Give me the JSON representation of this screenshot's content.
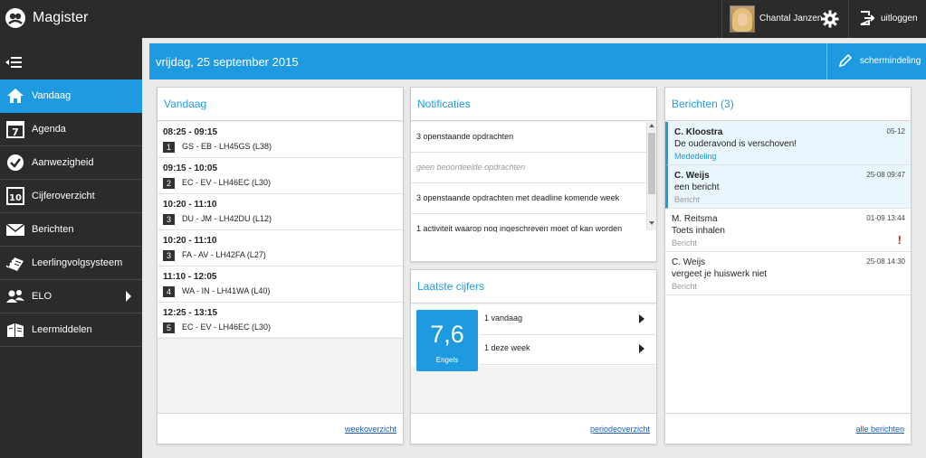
{
  "topbar": {
    "app_title": "Magister",
    "user_name": "Chantal Janzen",
    "logout_label": "uitloggen"
  },
  "sidebar": {
    "items": [
      {
        "label": "Vandaag",
        "icon": "home-icon",
        "active": true
      },
      {
        "label": "Agenda",
        "icon": "calendar-icon"
      },
      {
        "label": "Aanwezigheid",
        "icon": "check-icon"
      },
      {
        "label": "Cijferoverzicht",
        "icon": "grade-10-icon"
      },
      {
        "label": "Berichten",
        "icon": "envelope-icon"
      },
      {
        "label": "Leerlingvolgsysteem",
        "icon": "notebook-icon"
      },
      {
        "label": "ELO",
        "icon": "people-icon",
        "has_submenu": true
      },
      {
        "label": "Leermiddelen",
        "icon": "books-icon"
      }
    ]
  },
  "header": {
    "date": "vrijdag, 25 september 2015",
    "layout_label": "schermindeling"
  },
  "vandaag": {
    "title": "Vandaag",
    "lessons": [
      {
        "time": "08:25 - 09:15",
        "hour": "1",
        "desc": "GS - EB - LH45GS (L38)"
      },
      {
        "time": "09:15 - 10:05",
        "hour": "2",
        "desc": "EC - EV - LH46EC (L30)"
      },
      {
        "time": "10:20 - 11:10",
        "hour": "3",
        "desc": "DU - JM - LH42DU (L12)"
      },
      {
        "time": "10:20 - 11:10",
        "hour": "3",
        "desc": "FA - AV - LH42FA (L27)"
      },
      {
        "time": "11:10 - 12:05",
        "hour": "4",
        "desc": "WA - IN - LH41WA (L40)"
      },
      {
        "time": "12:25 - 13:15",
        "hour": "5",
        "desc": "EC - EV - LH46EC (L30)"
      }
    ],
    "footer_link": "weekoverzicht"
  },
  "notificaties": {
    "title": "Notificaties",
    "items": [
      {
        "text": "3 openstaande opdrachten",
        "muted": false
      },
      {
        "text": "geen beoordeelde opdrachten",
        "muted": true
      },
      {
        "text": "3 openstaande opdrachten met deadline komende week",
        "muted": false
      },
      {
        "text": "1 activiteit waarop nog ingeschreven moet of kan worden",
        "muted": false
      }
    ]
  },
  "cijfers": {
    "title": "Laatste cijfers",
    "grade": "7,6",
    "subject": "Engels",
    "rows": [
      "1 vandaag",
      "1 deze week"
    ],
    "footer_link": "periodeoverzicht"
  },
  "berichten": {
    "title": "Berichten (3)",
    "messages": [
      {
        "from": "C. Kloostra",
        "date": "05-12",
        "subject": "De ouderavond is verschoven!",
        "type": "Mededeling",
        "unread": true,
        "flag": ""
      },
      {
        "from": "C. Weijs",
        "date": "25-08 09:47",
        "subject": "een bericht",
        "type": "Bericht",
        "unread": true,
        "flag": ""
      },
      {
        "from": "M. Reitsma",
        "date": "01-09 13:44",
        "subject": "Toets inhalen",
        "type": "Bericht",
        "unread": false,
        "flag": "!"
      },
      {
        "from": "C. Weijs",
        "date": "25-08 14:30",
        "subject": "vergeet je huiswerk niet",
        "type": "Bericht",
        "unread": false,
        "flag": ""
      }
    ],
    "footer_link": "alle berichten"
  },
  "colors": {
    "accent": "#1e9be0",
    "topbar": "#2b2b2b",
    "flag": "#e0201b"
  }
}
